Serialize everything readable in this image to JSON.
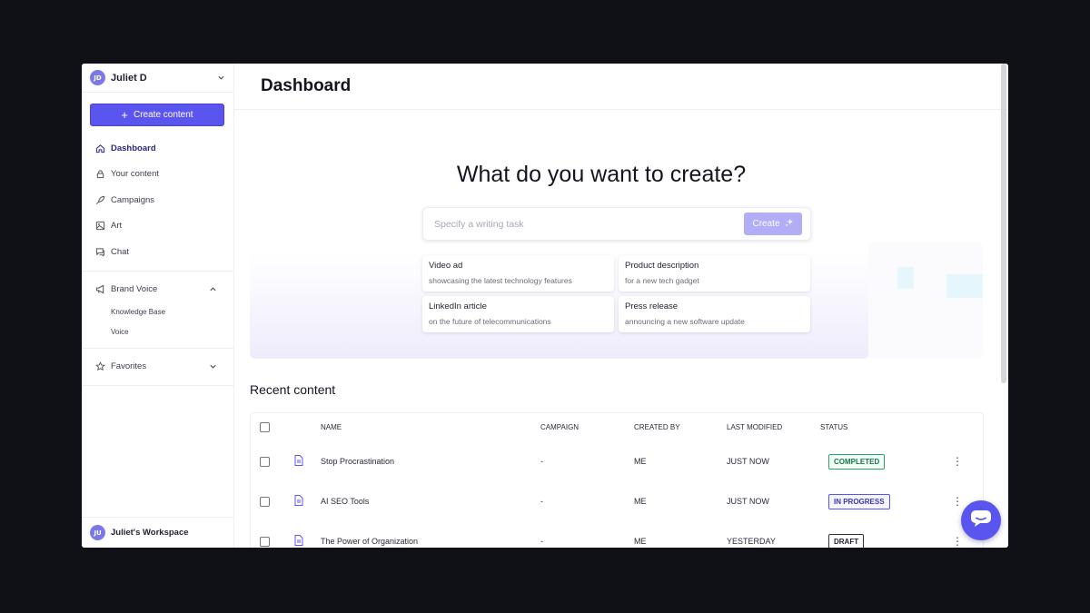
{
  "user": {
    "initials": "JD",
    "name": "Juliet D"
  },
  "sidebar": {
    "create_label": "Create content",
    "nav": [
      {
        "label": "Dashboard",
        "icon": "home-icon"
      },
      {
        "label": "Your content",
        "icon": "lock-icon"
      },
      {
        "label": "Campaigns",
        "icon": "rocket-icon"
      },
      {
        "label": "Art",
        "icon": "image-icon"
      },
      {
        "label": "Chat",
        "icon": "chat-icon"
      }
    ],
    "brand_voice": {
      "label": "Brand Voice",
      "items": [
        "Knowledge Base",
        "Voice"
      ]
    },
    "favorites": {
      "label": "Favorites"
    },
    "workspace": {
      "initials": "JU",
      "name": "Juliet's Workspace"
    }
  },
  "header": {
    "title": "Dashboard"
  },
  "hero": {
    "title": "What do you want to create?",
    "placeholder": "Specify a writing task",
    "create_label": "Create",
    "suggestions": [
      {
        "title": "Video ad",
        "desc": "showcasing the latest technology features"
      },
      {
        "title": "Product description",
        "desc": "for a new tech gadget"
      },
      {
        "title": "LinkedIn article",
        "desc": "on the future of telecommunications"
      },
      {
        "title": "Press release",
        "desc": "announcing a new software update"
      }
    ]
  },
  "recent": {
    "title": "Recent content",
    "columns": {
      "name": "NAME",
      "campaign": "CAMPAIGN",
      "created_by": "CREATED BY",
      "last_modified": "LAST MODIFIED",
      "status": "STATUS"
    },
    "rows": [
      {
        "name": "Stop Procrastination",
        "campaign": "-",
        "created_by": "ME",
        "last_modified": "JUST NOW",
        "status": "COMPLETED"
      },
      {
        "name": "AI SEO Tools",
        "campaign": "-",
        "created_by": "ME",
        "last_modified": "JUST NOW",
        "status": "IN PROGRESS"
      },
      {
        "name": "The Power of Organization",
        "campaign": "-",
        "created_by": "ME",
        "last_modified": "YESTERDAY",
        "status": "DRAFT"
      }
    ]
  },
  "colors": {
    "accent": "#5b55f0",
    "completed": "#2aa36c",
    "in_progress": "#5b55f0",
    "draft": "#333333"
  }
}
